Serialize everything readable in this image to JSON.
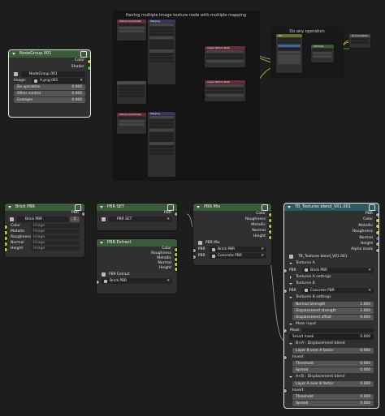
{
  "nodegroup": {
    "title": "NodeGroup.001",
    "out_color": "Color",
    "out_shader": "Shader",
    "datablock": "NodeGroup.001",
    "image_label": "Image:",
    "image_name": "A.png.001",
    "fields": [
      {
        "label": "Do operation",
        "value": "0.000"
      },
      {
        "label": "Other control",
        "value": "0.000"
      },
      {
        "label": "Example",
        "value": "0.000"
      }
    ]
  },
  "frame_texture": {
    "title": "Having multiple image texture node with multiple mapping"
  },
  "frame_op": {
    "title": "Do any operation"
  },
  "brick": {
    "title": "Brick PBR",
    "out": "PBR",
    "datablock": "Brick PBR",
    "users": "3",
    "rows": [
      {
        "label": "Color",
        "value": "Image"
      },
      {
        "label": "Metallic",
        "value": "Image"
      },
      {
        "label": "Roughness",
        "value": "Image"
      },
      {
        "label": "Normal",
        "value": "Image"
      },
      {
        "label": "Height",
        "value": "Image"
      }
    ]
  },
  "pbrset": {
    "title": "PBR SET",
    "out": "PBR",
    "datablock": "PBR SET"
  },
  "extract": {
    "title": "PBR Extract",
    "outs": [
      "Color",
      "Roughness",
      "Metallic",
      "Normal",
      "Height"
    ],
    "datablock": "PBR Extract",
    "input": "Brick PBR"
  },
  "mix": {
    "title": "PBR Mix",
    "outs": [
      "Color",
      "Roughness",
      "Metallic",
      "Normal",
      "Height"
    ],
    "datablock": "PBR Mix",
    "inputs": [
      {
        "label": "PBR",
        "value": "Brick PBR"
      },
      {
        "label": "PBR",
        "value": "Concrete PBR"
      }
    ]
  },
  "tb": {
    "title": "TB_Textures blend_V01.001",
    "outs": [
      "PBR",
      "Color",
      "Metallic",
      "Roughness",
      "Normal",
      "Height",
      "Alpha mask"
    ],
    "datablock": "TB_Textures blend_V01.001",
    "tex_a": "Textures A",
    "pbr_a_label": "PBR",
    "pbr_a": "Brick PBR",
    "tex_a_settings": "Textures A settings",
    "tex_b": "Textures B",
    "pbr_b_label": "PBR",
    "pbr_b": "Concrete PBR",
    "tex_b_settings": "Textures B settings",
    "b_fields": [
      {
        "label": "Normal Strength",
        "value": "1.000"
      },
      {
        "label": "Displacement strength",
        "value": "1.000"
      },
      {
        "label": "Displacement offset",
        "value": "0.000"
      }
    ],
    "mask_input": "Mask input",
    "mask_label": "Mask",
    "smart_mask": {
      "label": "Smart mask",
      "value": "0.000"
    },
    "bva": "B<A : Displacement blend",
    "bva_fields": [
      {
        "label": "Layer B over A factor",
        "value": "0.000"
      },
      {
        "label": "Invert",
        "value": ""
      },
      {
        "label": "Threshold",
        "value": "0.000"
      },
      {
        "label": "Spread",
        "value": "0.000"
      }
    ],
    "avb": "A<B : Displacement blend",
    "avb_fields": [
      {
        "label": "Layer A over B factor",
        "value": "0.000"
      },
      {
        "label": "Invert",
        "value": ""
      },
      {
        "label": "Threshold",
        "value": "0.000"
      },
      {
        "label": "Spread",
        "value": "0.000"
      }
    ]
  },
  "mini": {
    "texcoord": "Texture Coordinate",
    "mapping": "Mapping",
    "mapping_mode": "Point",
    "img1": "Image Texture Node",
    "img2": "Image Texture Node",
    "mix_node": "Mix",
    "mix_mode": "Mix",
    "group_out": "Group Output",
    "group_in": "Group Input",
    "attribute": "Attribute",
    "multiply": "Multiply"
  }
}
